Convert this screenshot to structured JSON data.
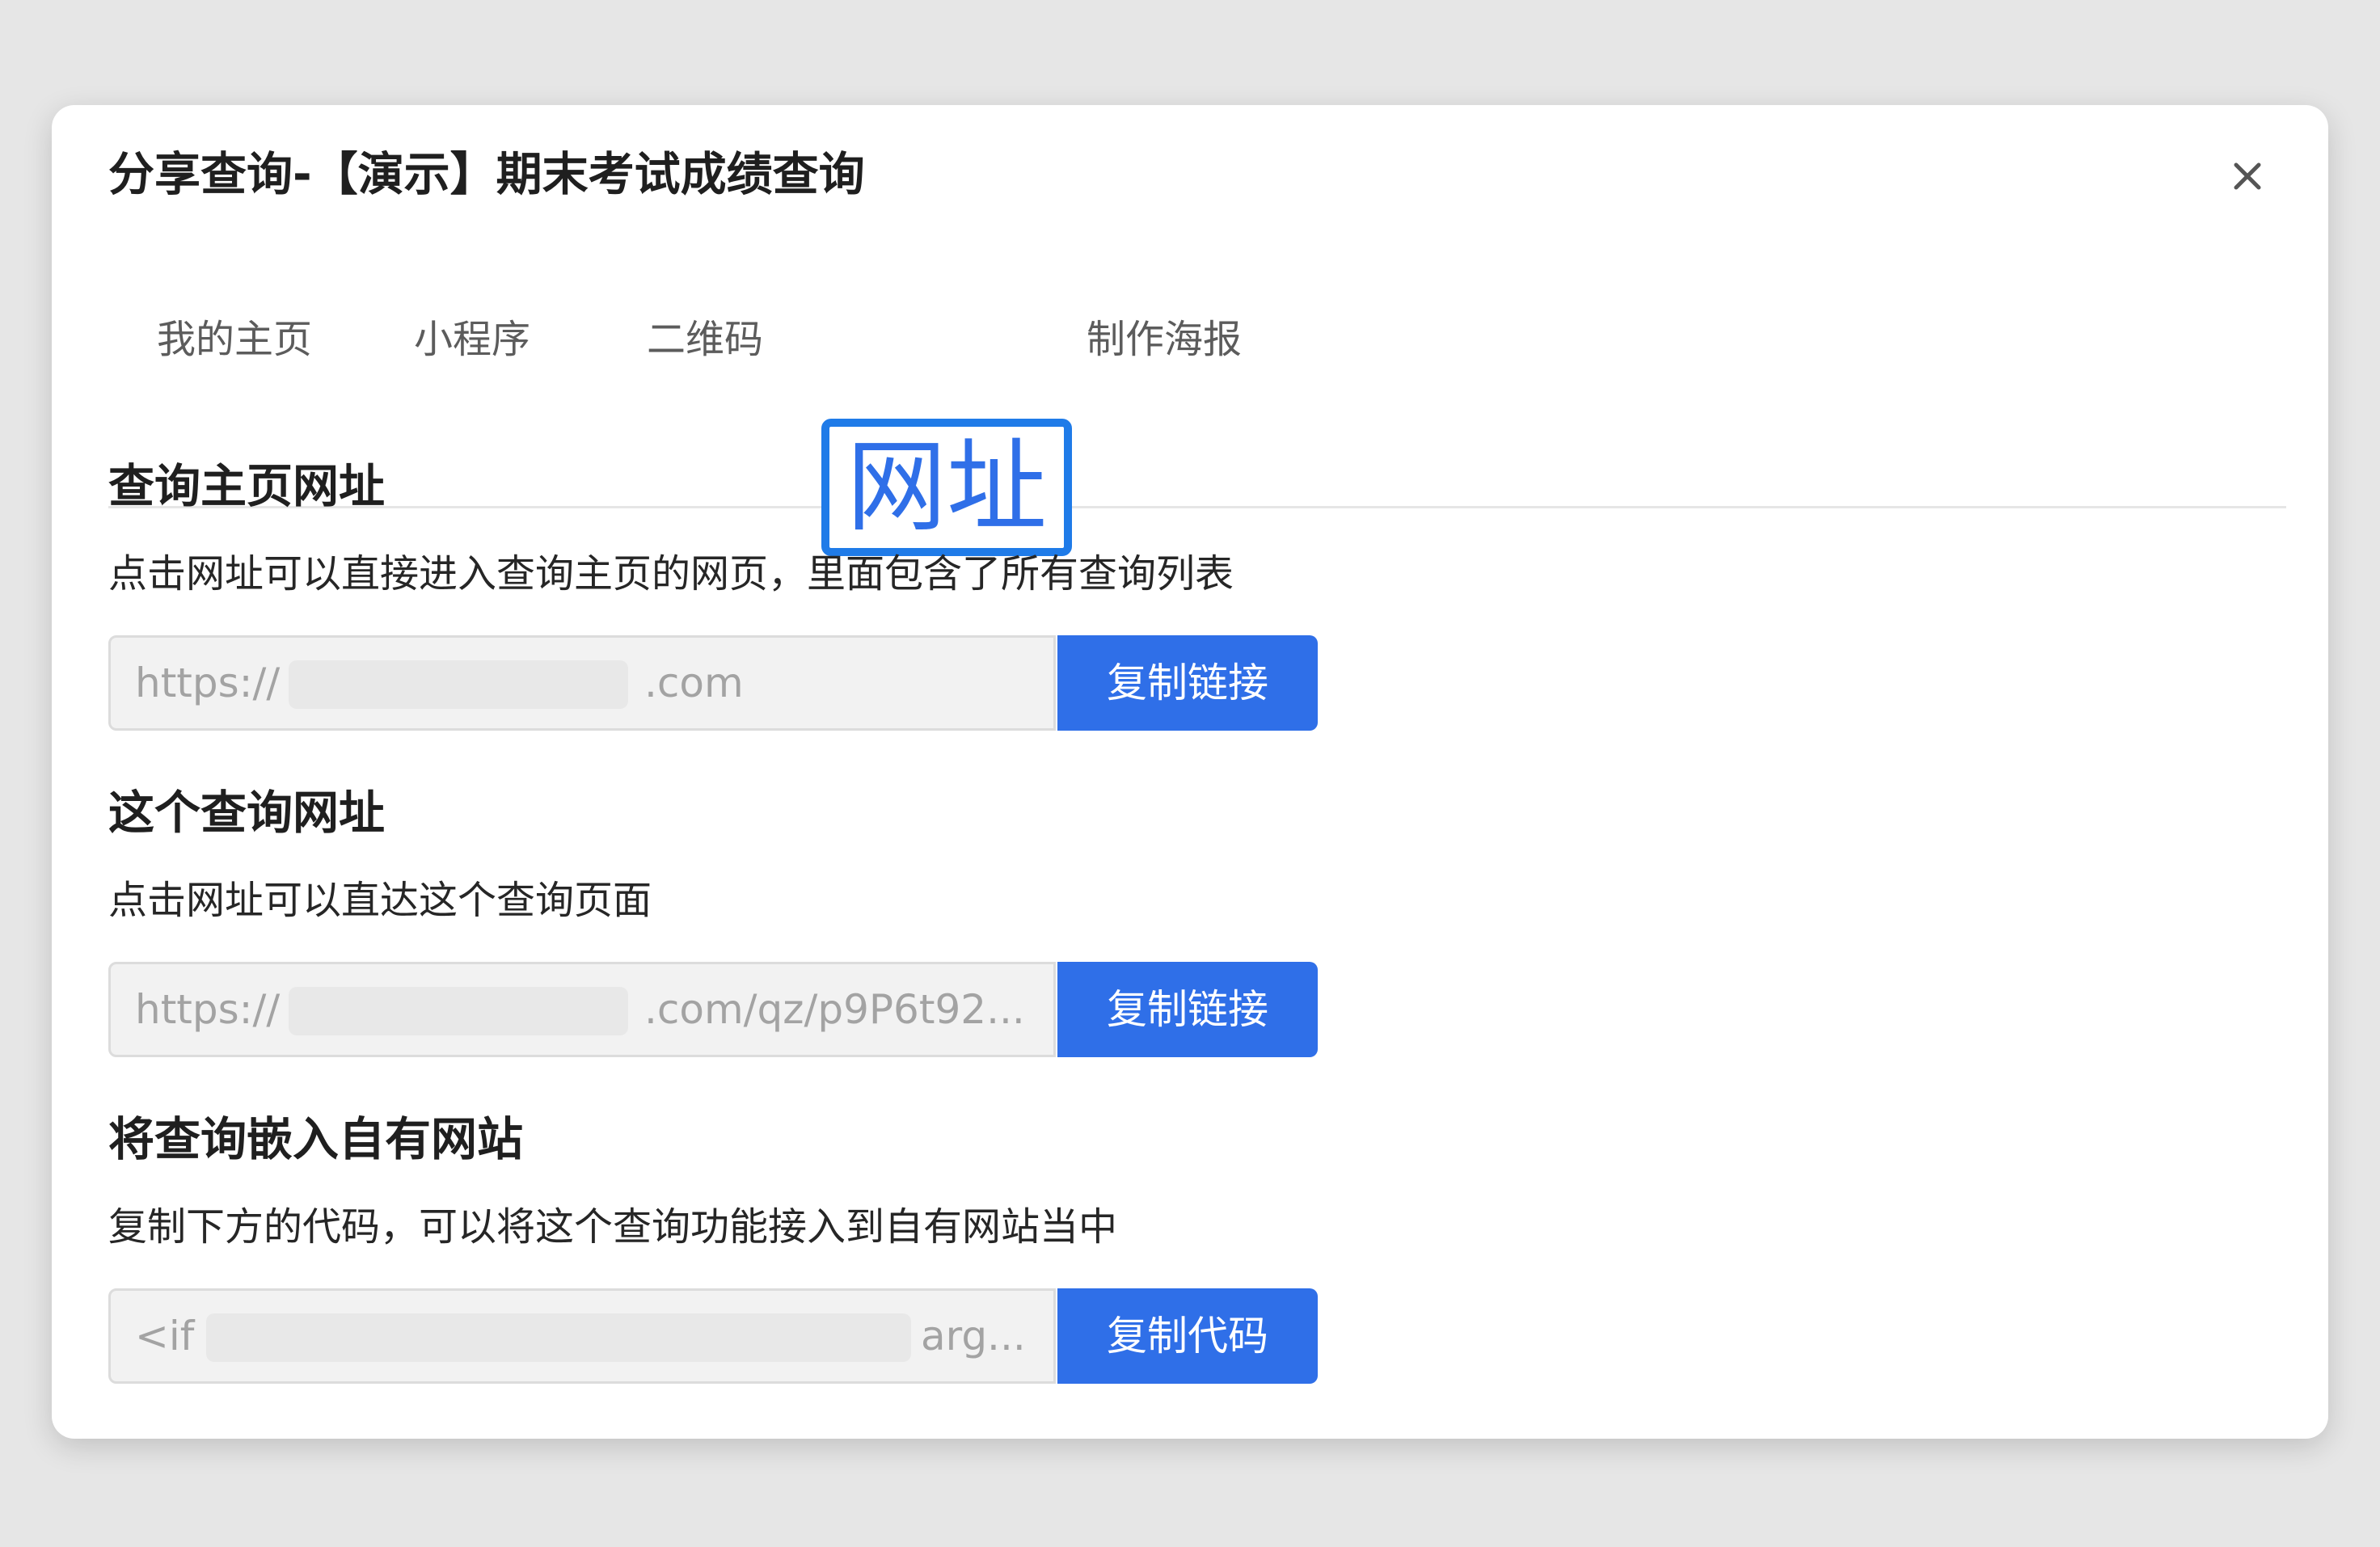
{
  "dialog": {
    "title": "分享查询-【演示】期末考试成绩查询"
  },
  "tabs": [
    {
      "label": "我的主页"
    },
    {
      "label": "小程序"
    },
    {
      "label": "二维码"
    },
    {
      "label": "网址",
      "active": true
    },
    {
      "label": "制作海报"
    }
  ],
  "sections": [
    {
      "heading": "查询主页网址",
      "description": "点击网址可以直接进入查询主页的网页，里面包含了所有查询列表",
      "url_prefix": "https://",
      "url_suffix": ".com",
      "button": "复制链接"
    },
    {
      "heading": "这个查询网址",
      "description": "点击网址可以直达这个查询页面",
      "url_prefix": "https://",
      "url_suffix": ".com/qz/p9P6t92...",
      "button": "复制链接"
    },
    {
      "heading": "将查询嵌入自有网站",
      "description": "复制下方的代码，可以将这个查询功能接入到自有网站当中",
      "url_prefix": "<if",
      "url_suffix": "arg...",
      "button": "复制代码"
    }
  ],
  "icons": {
    "close": "close-icon"
  },
  "colors": {
    "accent": "#2f6fe8",
    "highlight_border": "#1f7be8",
    "input_bg": "#f2f2f2",
    "page_bg": "#e6e6e6"
  }
}
